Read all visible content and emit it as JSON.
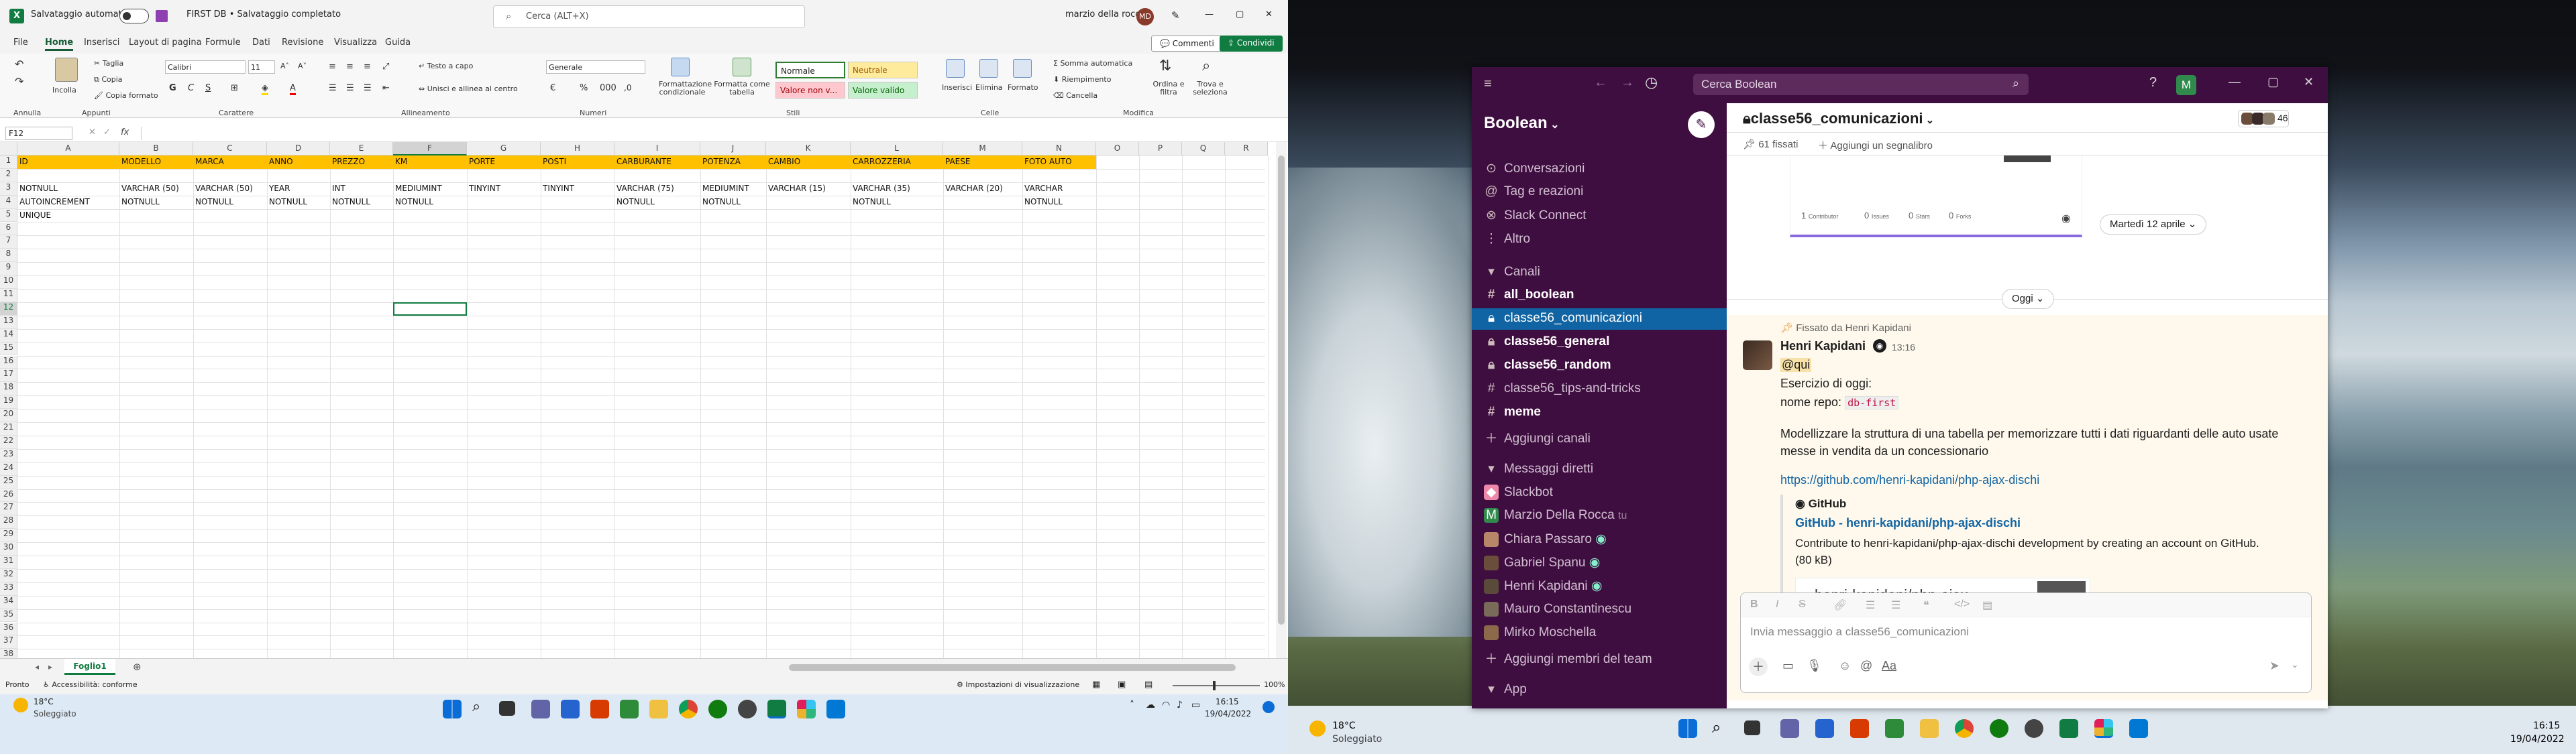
{
  "excel": {
    "autosave_label": "Salvataggio automatico",
    "doc_title": "FIRST DB • Salvataggio completato",
    "search_placeholder": "Cerca (ALT+X)",
    "user_name": "marzio della rocca",
    "user_initials": "MD",
    "menu": [
      "File",
      "Home",
      "Inserisci",
      "Layout di pagina",
      "Formule",
      "Dati",
      "Revisione",
      "Visualizza",
      "Guida"
    ],
    "comments_label": "Commenti",
    "share_label": "Condividi",
    "ribbon": {
      "paste": "Incolla",
      "cut": "Taglia",
      "copy": "Copia",
      "format_painter": "Copia formato",
      "font_name": "Calibri",
      "font_size": "11",
      "wrap_text": "Testo a capo",
      "merge_center": "Unisci e allinea al centro",
      "number_format": "Generale",
      "conditional": "Formattazione condizionale",
      "format_table": "Formatta come tabella",
      "styles": [
        "Normale",
        "Neutrale",
        "Valore non v...",
        "Valore valido"
      ],
      "insert": "Inserisci",
      "delete": "Elimina",
      "format": "Formato",
      "autosum": "Somma automatica",
      "fill": "Riempimento",
      "clear": "Cancella",
      "sort_filter": "Ordina e filtra",
      "find_select": "Trova e seleziona",
      "groups": [
        "Annulla",
        "Appunti",
        "Carattere",
        "Allineamento",
        "Numeri",
        "Stili",
        "Celle",
        "Modifica"
      ]
    },
    "name_box": "F12",
    "fx": "fx",
    "columns": [
      "A",
      "B",
      "C",
      "D",
      "E",
      "F",
      "G",
      "H",
      "I",
      "J",
      "K",
      "L",
      "M",
      "N",
      "O",
      "P",
      "Q",
      "R"
    ],
    "rows": {
      "r1": [
        "ID",
        "MODELLO",
        "MARCA",
        "ANNO",
        "PREZZO",
        "KM",
        "PORTE",
        "POSTI",
        "CARBURANTE",
        "POTENZA",
        "CAMBIO",
        "CARROZZERIA",
        "PAESE",
        "FOTO AUTO"
      ],
      "r3": [
        "NOTNULL",
        "VARCHAR (50)",
        "VARCHAR (50)",
        "YEAR",
        "INT",
        "MEDIUMINT",
        "TINYINT",
        "TINYINT",
        "VARCHAR (75)",
        "MEDIUMINT",
        "VARCHAR (15)",
        "VARCHAR (35)",
        "VARCHAR (20)",
        "VARCHAR"
      ],
      "r4": [
        "AUTOINCREMENT",
        "NOTNULL",
        "NOTNULL",
        "NOTNULL",
        "NOTNULL",
        "NOTNULL",
        "",
        "",
        "NOTNULL",
        "NOTNULL",
        "",
        "NOTNULL",
        "",
        "NOTNULL"
      ],
      "r5": [
        "UNIQUE"
      ]
    },
    "sheet_tab": "Foglio1",
    "status_ready": "Pronto",
    "status_access": "Accessibilità: conforme",
    "status_view": "Impostazioni di visualizzazione",
    "zoom": "100%",
    "weather_temp": "18°C",
    "weather_desc": "Soleggiato",
    "time": "16:15",
    "date": "19/04/2022"
  },
  "slack": {
    "search_placeholder": "Cerca Boolean",
    "workspace": "Boolean",
    "avatar_letter": "M",
    "nav": [
      "Conversazioni",
      "Tag e reazioni",
      "Slack Connect",
      "Altro"
    ],
    "channels_header": "Canali",
    "channels": [
      "all_boolean",
      "classe56_comunicazioni",
      "classe56_general",
      "classe56_random",
      "classe56_tips-and-tricks",
      "meme"
    ],
    "add_channels": "Aggiungi canali",
    "dm_header": "Messaggi diretti",
    "dms": [
      "Slackbot",
      "Marzio Della Rocca",
      "Chiara Passaro",
      "Gabriel Spanu",
      "Henri Kapidani",
      "Mauro Constantinescu",
      "Mirko Moschella"
    ],
    "dm_you": "tu",
    "add_members": "Aggiungi membri del team",
    "app_header": "App",
    "channel_title": "classe56_comunicazioni",
    "member_count": "46",
    "pinned": "61 fissati",
    "add_bookmark": "Aggiungi un segnalibro",
    "date_pill": "Martedì 12 aprile",
    "today_pill": "Oggi",
    "pinned_by": "Fissato da Henri Kapidani",
    "author": "Henri Kapidani",
    "msg_time": "13:16",
    "mention": "@qui",
    "line1": "Esercizio di oggi:",
    "line2_label": "nome repo:",
    "repo_code": "db-first",
    "paragraph": "Modellizzare la struttura di una tabella per memorizzare tutti i dati riguardanti delle auto usate messe in vendita da un concessionario",
    "link": "https://github.com/henri-kapidani/php-ajax-dischi",
    "unfurl_site": "GitHub",
    "unfurl_title": "GitHub - henri-kapidani/php-ajax-dischi",
    "unfurl_desc": "Contribute to henri-kapidani/php-ajax-dischi development by creating an account on GitHub. (80 kB)",
    "unfurl_img_text": "henri-kapidani/php-ajax-",
    "gh_stats": [
      "1",
      "0",
      "0",
      "0"
    ],
    "gh_stat_labels": [
      "Contributor",
      "Issues",
      "Stars",
      "Forks"
    ],
    "composer_placeholder": "Invia messaggio a classe56_comunicazioni"
  },
  "desktop": {
    "weather_temp": "18°C",
    "weather_desc": "Soleggiato",
    "time": "16:15",
    "date": "19/04/2022"
  }
}
